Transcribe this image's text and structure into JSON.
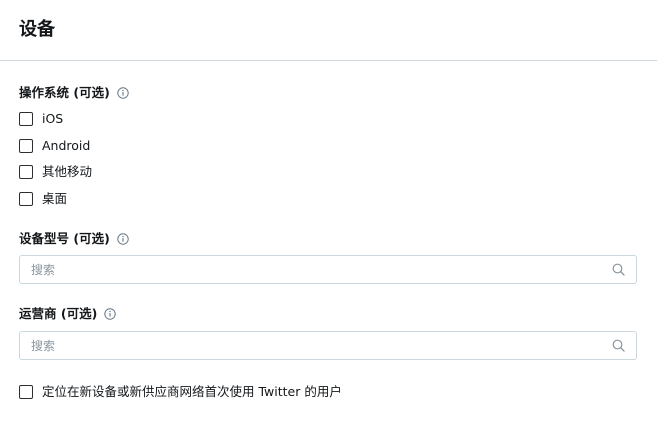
{
  "header": {
    "title": "设备"
  },
  "os_section": {
    "label": "操作系统 (可选)",
    "options": [
      {
        "label": "iOS",
        "checked": false
      },
      {
        "label": "Android",
        "checked": false
      },
      {
        "label": "其他移动",
        "checked": false
      },
      {
        "label": "桌面",
        "checked": false
      }
    ]
  },
  "device_model": {
    "label": "设备型号 (可选)",
    "search_placeholder": "搜索"
  },
  "carrier": {
    "label": "运营商 (可选)",
    "search_placeholder": "搜索"
  },
  "new_device_option": {
    "label": "定位在新设备或新供应商网络首次使用 Twitter 的用户",
    "checked": false
  },
  "icons": {
    "info": "info-icon",
    "search": "search-icon"
  },
  "colors": {
    "text": "#14171a",
    "border": "#ccd6dd",
    "placeholder": "#8a959e"
  }
}
